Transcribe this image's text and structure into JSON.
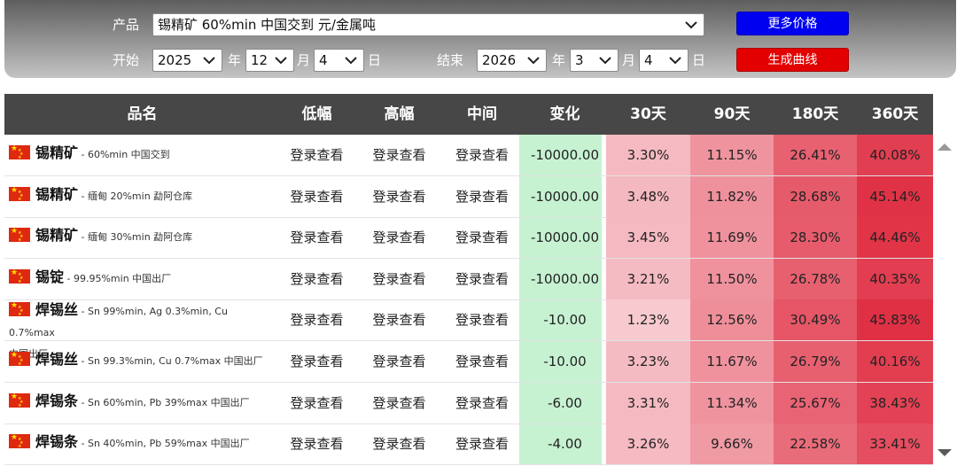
{
  "filters": {
    "product_label": "产品",
    "product_value": "锡精矿 60%min 中国交到 元/金属吨",
    "start_label": "开始",
    "end_label": "结束",
    "start": {
      "year": "2025",
      "month": "12",
      "day": "4"
    },
    "end": {
      "year": "2026",
      "month": "3",
      "day": "4"
    },
    "year_unit": "年",
    "month_unit": "月",
    "day_unit": "日",
    "more_prices": "更多价格",
    "generate_curve": "生成曲线"
  },
  "colors": {
    "more_prices_button": "#0000f0",
    "generate_curve_button": "#e30000",
    "change_column": "#c6f2d2",
    "header_bg": "#474747"
  },
  "table": {
    "headers": [
      "品名",
      "低幅",
      "高幅",
      "中间",
      "变化",
      "30天",
      "90天",
      "180天",
      "360天"
    ],
    "rows": [
      {
        "name": "锡精矿",
        "spec": "60%min 中国交到",
        "low": "登录查看",
        "high": "登录查看",
        "mid": "登录查看",
        "change": "-10000.00",
        "d30": "3.30%",
        "d90": "11.15%",
        "d180": "26.41%",
        "d360": "40.08%"
      },
      {
        "name": "锡精矿",
        "spec": "缅甸 20%min 勐阿仓库",
        "low": "登录查看",
        "high": "登录查看",
        "mid": "登录查看",
        "change": "-10000.00",
        "d30": "3.48%",
        "d90": "11.82%",
        "d180": "28.68%",
        "d360": "45.14%"
      },
      {
        "name": "锡精矿",
        "spec": "缅甸 30%min 勐阿仓库",
        "low": "登录查看",
        "high": "登录查看",
        "mid": "登录查看",
        "change": "-10000.00",
        "d30": "3.45%",
        "d90": "11.69%",
        "d180": "28.30%",
        "d360": "44.46%"
      },
      {
        "name": "锡锭",
        "spec": "99.95%min 中国出厂",
        "low": "登录查看",
        "high": "登录查看",
        "mid": "登录查看",
        "change": "-10000.00",
        "d30": "3.21%",
        "d90": "11.50%",
        "d180": "26.78%",
        "d360": "40.35%"
      },
      {
        "name": "焊锡丝",
        "spec": "Sn 99%min, Ag 0.3%min, Cu 0.7%max",
        "spec2": "中国出厂",
        "low": "登录查看",
        "high": "登录查看",
        "mid": "登录查看",
        "change": "-10.00",
        "d30": "1.23%",
        "d90": "12.56%",
        "d180": "30.49%",
        "d360": "45.83%"
      },
      {
        "name": "焊锡丝",
        "spec": "Sn 99.3%min, Cu 0.7%max 中国出厂",
        "low": "登录查看",
        "high": "登录查看",
        "mid": "登录查看",
        "change": "-10.00",
        "d30": "3.23%",
        "d90": "11.67%",
        "d180": "26.79%",
        "d360": "40.16%"
      },
      {
        "name": "焊锡条",
        "spec": "Sn 60%min, Pb 39%max 中国出厂",
        "low": "登录查看",
        "high": "登录查看",
        "mid": "登录查看",
        "change": "-6.00",
        "d30": "3.31%",
        "d90": "11.34%",
        "d180": "25.67%",
        "d360": "38.43%"
      },
      {
        "name": "焊锡条",
        "spec": "Sn 40%min, Pb 59%max 中国出厂",
        "low": "登录查看",
        "high": "登录查看",
        "mid": "登录查看",
        "change": "-4.00",
        "d30": "3.26%",
        "d90": "9.66%",
        "d180": "22.58%",
        "d360": "33.41%"
      }
    ]
  },
  "icons": {
    "flag": "china-flag-icon",
    "dropdown": "chevron-down-icon",
    "scroll_up": "scroll-up-arrow-icon",
    "scroll_down": "scroll-down-arrow-icon"
  }
}
